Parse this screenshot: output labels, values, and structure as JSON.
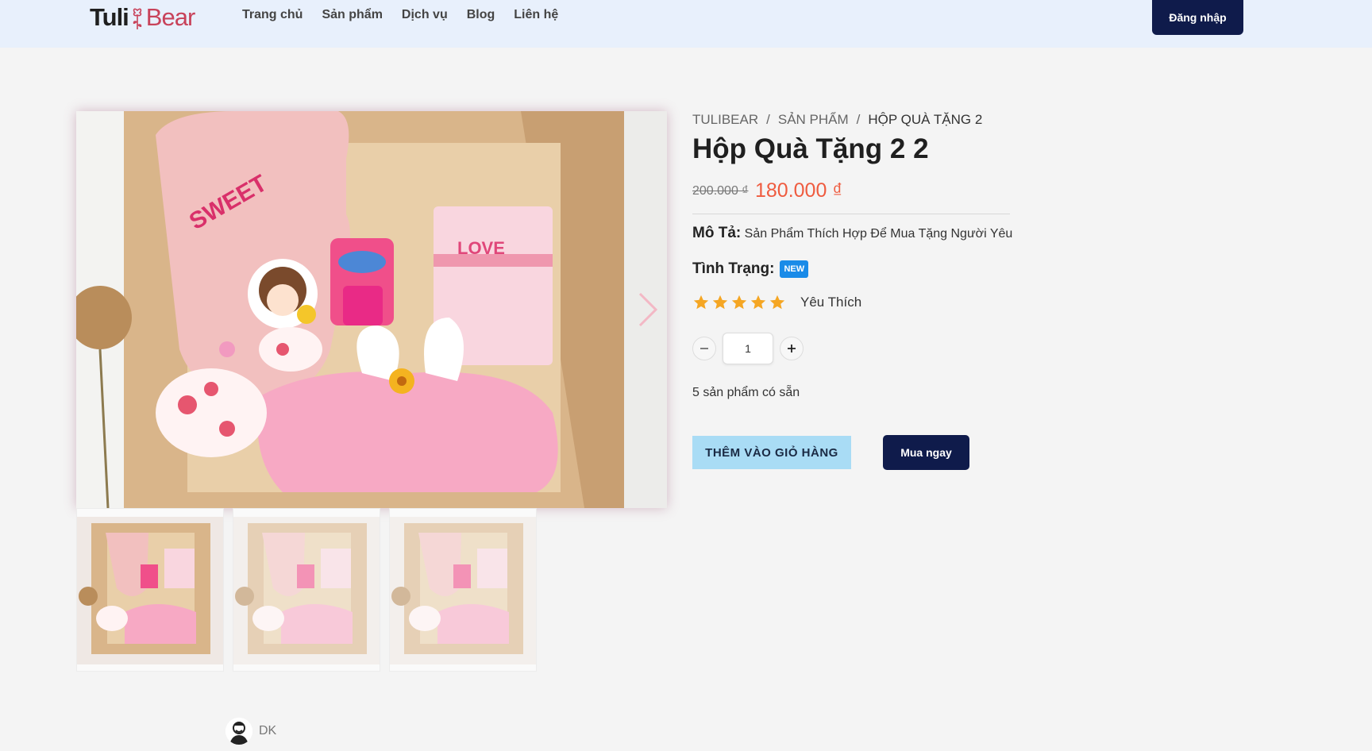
{
  "header": {
    "logo_left": "Tuli",
    "logo_right": "Bear",
    "nav": [
      "Trang chủ",
      "Sản phẩm",
      "Dịch vụ",
      "Blog",
      "Liên hệ"
    ],
    "login_label": "Đăng nhập"
  },
  "breadcrumb": [
    "TULIBEAR",
    "SẢN PHẨM",
    "HỘP QUÀ TẶNG 2"
  ],
  "breadcrumb_sep": "/",
  "product": {
    "title": "Hộp Quà Tặng 2 2",
    "old_price": "200.000 ₫",
    "new_price": "180.000 ₫",
    "desc_label": "Mô Tả:",
    "desc_text": "Sản Phẩm Thích Hợp Để Mua Tặng Người Yêu",
    "status_label": "Tình Trạng:",
    "status_badge": "NEW",
    "rating_stars": 5,
    "rating_label": "Yêu Thích",
    "quantity": "1",
    "stock": "5 sản phẩm có sẵn",
    "add_to_cart": "THÊM VÀO GIỎ HÀNG",
    "buy_now": "Mua ngay"
  },
  "colors": {
    "header_bg": "#e8f0fc",
    "navy": "#0f1b4b",
    "price": "#ef5b3f",
    "star": "#f5a623",
    "badge": "#1a8be8",
    "cart_btn": "#a9dcf5"
  },
  "thumbnails_count": 3,
  "author": {
    "name": "DK"
  }
}
